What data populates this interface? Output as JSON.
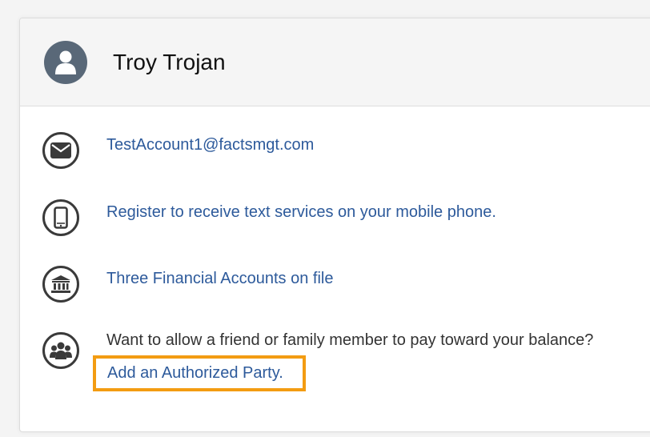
{
  "profile": {
    "name": "Troy Trojan",
    "avatar_icon": "user-icon"
  },
  "contact_items": [
    {
      "icon": "envelope-icon",
      "text": "TestAccount1@factsmgt.com"
    },
    {
      "icon": "mobile-phone-icon",
      "text": "Register to receive text services on your mobile phone."
    },
    {
      "icon": "bank-icon",
      "text": "Three Financial Accounts on file"
    }
  ],
  "authorized_party": {
    "icon": "group-icon",
    "prompt": "Want to allow a friend or family member to pay toward your balance?",
    "link_label": "Add an Authorized Party."
  },
  "colors": {
    "link": "#2d5a9b",
    "highlight": "#f39c12",
    "avatar": "#596878"
  }
}
